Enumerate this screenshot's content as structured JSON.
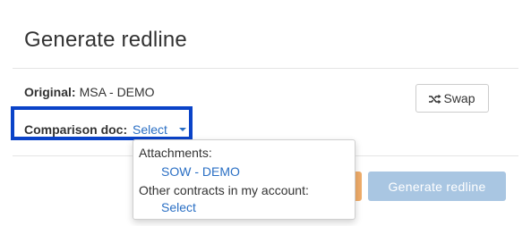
{
  "dialog": {
    "title": "Generate redline"
  },
  "original": {
    "label": "Original:",
    "value": "MSA - DEMO"
  },
  "swap": {
    "label": "Swap",
    "icon": "shuffle-icon"
  },
  "comparison": {
    "label": "Comparison doc:",
    "select_label": "Select",
    "highlight_color": "#0a43c8"
  },
  "dropdown": {
    "attachments_header": "Attachments:",
    "attachment_item": "SOW - DEMO",
    "other_header": "Other contracts in my account:",
    "other_item": "Select"
  },
  "footer": {
    "generate_label": "Generate redline",
    "generate_color": "#a9c6e2",
    "partial_button_color": "#f0ad6a"
  },
  "colors": {
    "link": "#2a6fc4",
    "text": "#333333"
  }
}
